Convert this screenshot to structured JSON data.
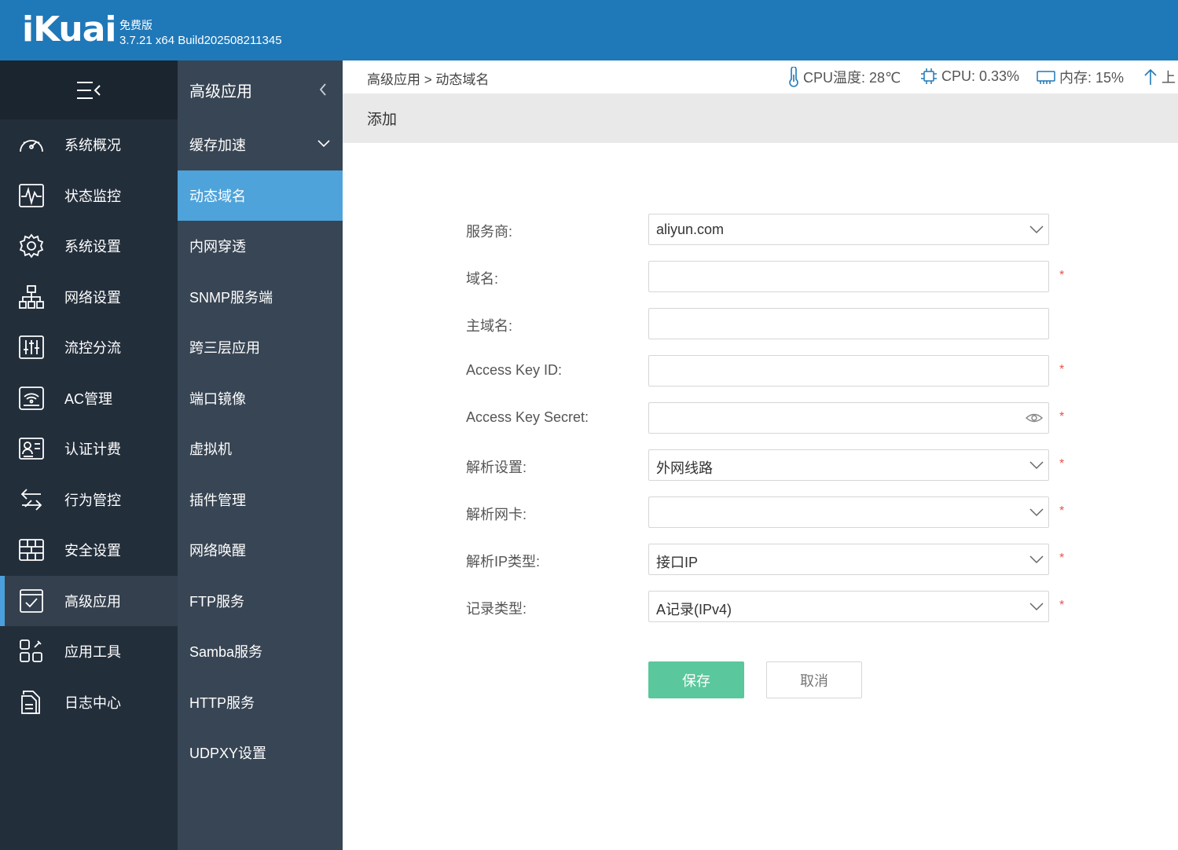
{
  "header": {
    "logo": "iKuai",
    "edition": "免费版",
    "version": "3.7.21 x64 Build202508211345"
  },
  "sidebar": {
    "items": [
      {
        "label": "系统概况",
        "icon": "dashboard-icon"
      },
      {
        "label": "状态监控",
        "icon": "pulse-monitor-icon"
      },
      {
        "label": "系统设置",
        "icon": "gear-icon"
      },
      {
        "label": "网络设置",
        "icon": "network-topology-icon"
      },
      {
        "label": "流控分流",
        "icon": "sliders-icon"
      },
      {
        "label": "AC管理",
        "icon": "wifi-router-icon"
      },
      {
        "label": "认证计费",
        "icon": "id-card-icon"
      },
      {
        "label": "行为管控",
        "icon": "swap-arrows-icon"
      },
      {
        "label": "安全设置",
        "icon": "firewall-icon"
      },
      {
        "label": "高级应用",
        "icon": "checklist-icon",
        "active": true
      },
      {
        "label": "应用工具",
        "icon": "app-grid-icon"
      },
      {
        "label": "日志中心",
        "icon": "log-file-icon"
      }
    ]
  },
  "submenu": {
    "title": "高级应用",
    "items": [
      {
        "label": "缓存加速",
        "expandable": true
      },
      {
        "label": "动态域名",
        "active": true
      },
      {
        "label": "内网穿透"
      },
      {
        "label": "SNMP服务端"
      },
      {
        "label": "跨三层应用"
      },
      {
        "label": "端口镜像"
      },
      {
        "label": "虚拟机"
      },
      {
        "label": "插件管理"
      },
      {
        "label": "网络唤醒"
      },
      {
        "label": "FTP服务"
      },
      {
        "label": "Samba服务"
      },
      {
        "label": "HTTP服务"
      },
      {
        "label": "UDPXY设置"
      }
    ]
  },
  "topbar": {
    "breadcrumb": "高级应用 > 动态域名",
    "cpu_temp": "CPU温度: 28℃",
    "cpu_usage": "CPU: 0.33%",
    "memory": "内存: 15%",
    "upload": "上"
  },
  "section": {
    "title": "添加"
  },
  "form": {
    "provider": {
      "label": "服务商:",
      "value": "aliyun.com"
    },
    "domain": {
      "label": "域名:",
      "value": "",
      "required": "*"
    },
    "main_domain": {
      "label": "主域名:",
      "value": ""
    },
    "access_key_id": {
      "label": "Access Key ID:",
      "value": "",
      "required": "*"
    },
    "access_key_secret": {
      "label": "Access Key Secret:",
      "value": "",
      "required": "*"
    },
    "resolve_setting": {
      "label": "解析设置:",
      "value": "外网线路",
      "required": "*"
    },
    "resolve_nic": {
      "label": "解析网卡:",
      "value": "",
      "required": "*"
    },
    "resolve_ip_type": {
      "label": "解析IP类型:",
      "value": "接口IP",
      "required": "*"
    },
    "record_type": {
      "label": "记录类型:",
      "value": "A记录(IPv4)",
      "required": "*"
    },
    "save_label": "保存",
    "cancel_label": "取消"
  },
  "colors": {
    "header_bg": "#1f78b8",
    "sidebar_bg": "#232e3b",
    "submenu_bg": "#384554",
    "submenu_active": "#4ea3db",
    "save_button": "#5bc79c",
    "required": "#e8534c"
  }
}
